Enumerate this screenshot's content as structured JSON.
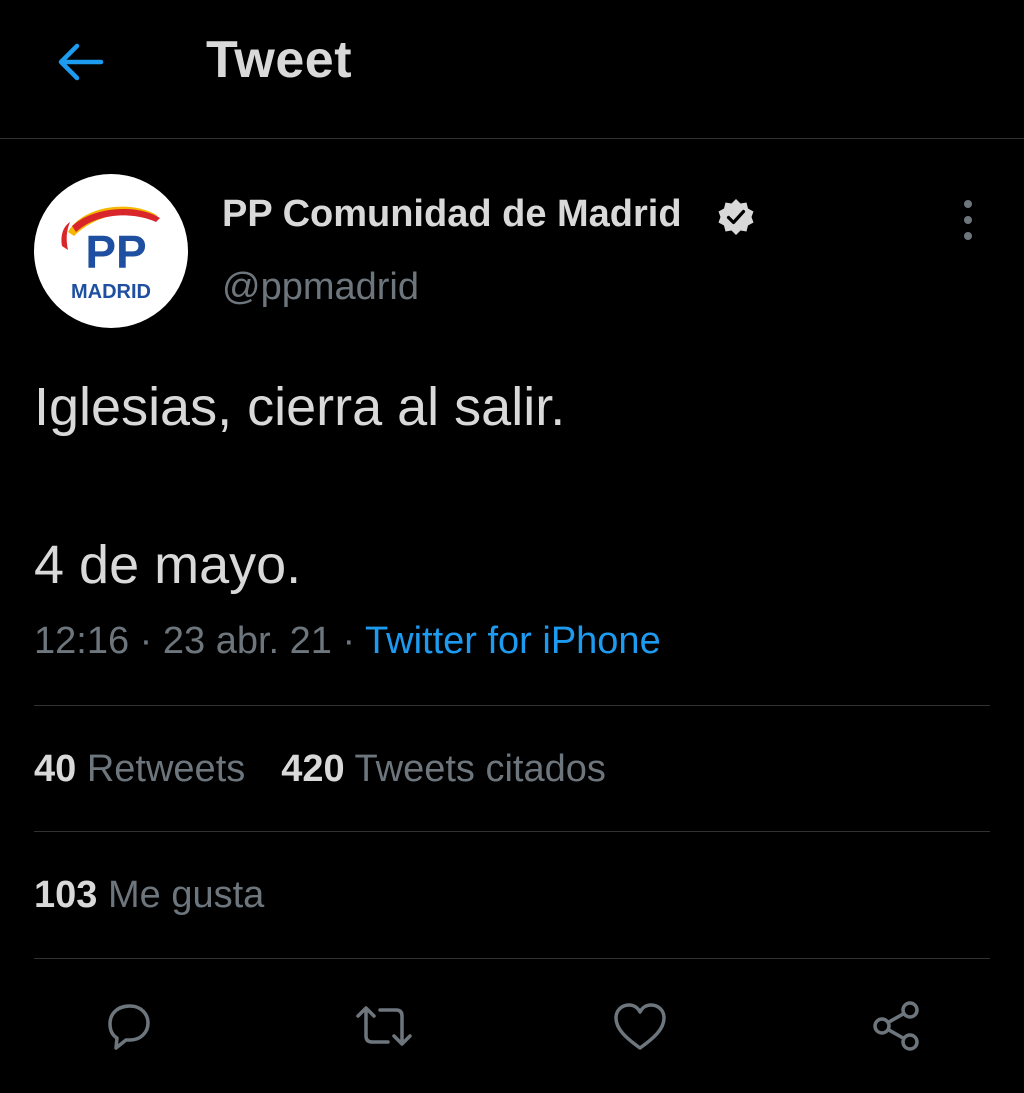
{
  "header": {
    "back_icon": "arrow-left-icon",
    "title": "Tweet"
  },
  "author": {
    "display_name": "PP Comunidad de Madrid",
    "handle": "@ppmadrid",
    "verified": true,
    "avatar_logo_text": "PP",
    "avatar_logo_subtext": "MADRID"
  },
  "tweet": {
    "line1": "Iglesias, cierra al salir.",
    "line2": "4 de mayo.",
    "time": "12:16",
    "separator": " · ",
    "date": "23 abr. 21",
    "source": "Twitter for iPhone"
  },
  "stats": {
    "retweets_count": "40",
    "retweets_label": "Retweets",
    "quotes_count": "420",
    "quotes_label": "Tweets citados",
    "likes_count": "103",
    "likes_label": "Me gusta"
  },
  "actions": [
    "reply-icon",
    "retweet-icon",
    "like-icon",
    "share-icon"
  ],
  "colors": {
    "background": "#000000",
    "text": "#d9d9d9",
    "muted": "#6e767d",
    "accent": "#1d9bf0",
    "divider": "#2f3336",
    "logo_blue": "#1f4fa0",
    "logo_red": "#d8262b",
    "logo_yellow": "#f5b800"
  }
}
